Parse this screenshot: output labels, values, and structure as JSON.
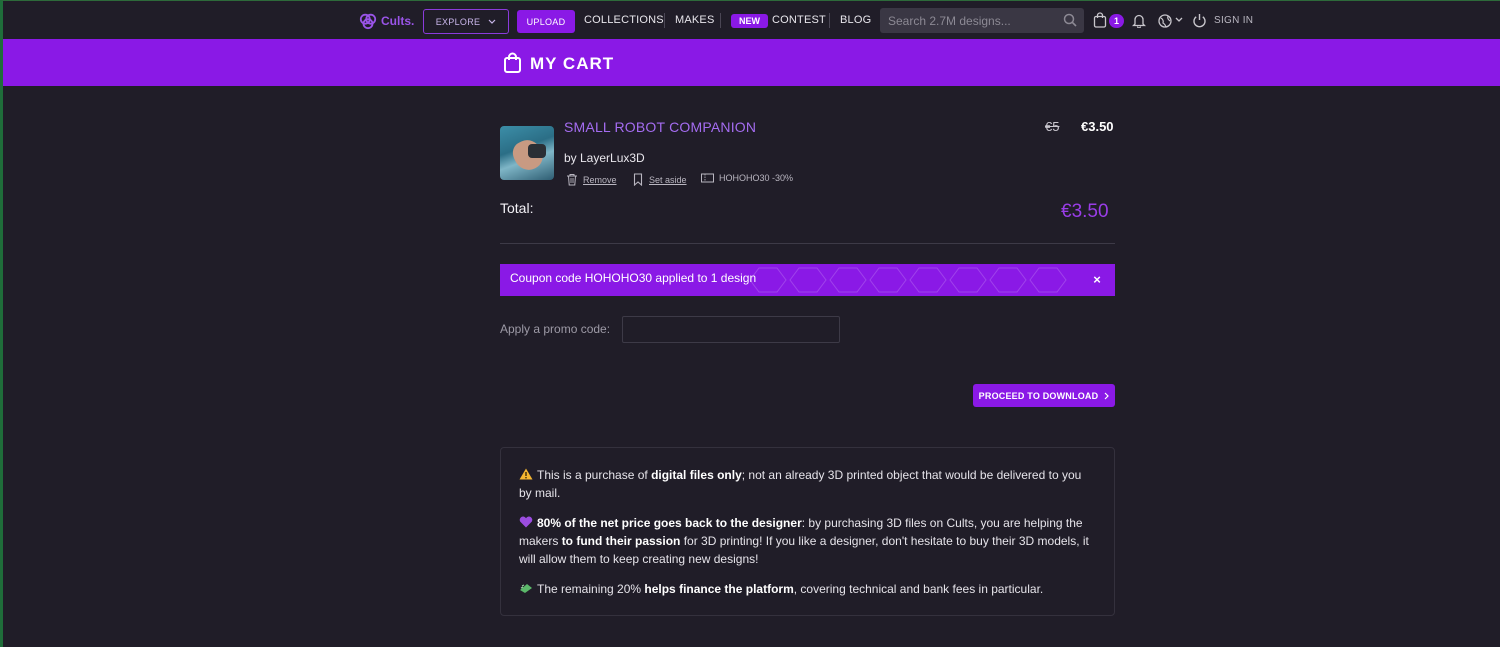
{
  "nav": {
    "logo_text": "Cults.",
    "explore_label": "EXPLORE",
    "upload_label": "UPLOAD",
    "collections_label": "COLLECTIONS",
    "makes_label": "MAKES",
    "new_badge": "NEW",
    "contest_label": "CONTEST",
    "blog_label": "BLOG",
    "search_placeholder": "Search 2.7M designs...",
    "cart_count": "1",
    "signin_label": "SIGN IN"
  },
  "banner": {
    "title": "MY CART"
  },
  "cart": {
    "item": {
      "title": "SMALL ROBOT COMPANION",
      "byline": "by LayerLux3D",
      "remove_label": "Remove",
      "set_aside_label": "Set aside",
      "coupon_tag": "HOHOHO30 -30%",
      "old_price": "€5",
      "new_price": "€3.50"
    },
    "total_label": "Total:",
    "total_value": "€3.50"
  },
  "coupon_alert": {
    "text": "Coupon code HOHOHO30 applied to 1 design",
    "close": "×"
  },
  "promo": {
    "label": "Apply a promo code:",
    "value": ""
  },
  "proceed_label": "PROCEED TO DOWNLOAD",
  "info": {
    "p1_pre": "This is a purchase of ",
    "p1_bold": "digital files only",
    "p1_post": "; not an already 3D printed object that would be delivered to you by mail.",
    "p2_bold1": "80% of the net price goes back to the designer",
    "p2_mid": ": by purchasing 3D files on Cults, you are helping the makers ",
    "p2_bold2": "to fund their passion",
    "p2_post": " for 3D printing! If you like a designer, don't hesitate to buy their 3D models, it will allow them to keep creating new designs!",
    "p3_pre": "The remaining 20% ",
    "p3_bold": "helps finance the platform",
    "p3_post": ", covering technical and bank fees in particular."
  },
  "colors": {
    "accent": "#8a19e6",
    "background": "#201d28",
    "link": "#a46cf0"
  }
}
